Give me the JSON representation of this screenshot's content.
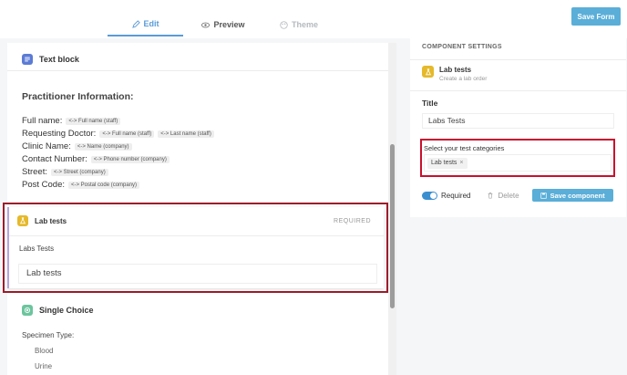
{
  "tabs": {
    "edit": "Edit",
    "preview": "Preview",
    "theme": "Theme"
  },
  "header": {
    "save_form": "Save Form"
  },
  "text_block": {
    "title": "Text block",
    "section_title": "Practitioner Information:",
    "lines": [
      {
        "label": "Full name:",
        "tags": [
          "<-> Full name (staff)"
        ]
      },
      {
        "label": "Requesting Doctor:",
        "tags": [
          "<-> Full name (staff)",
          "<-> Last name (staff)"
        ]
      },
      {
        "label": "Clinic Name:",
        "tags": [
          "<-> Name (company)"
        ]
      },
      {
        "label": "Contact Number:",
        "tags": [
          "<-> Phone number (company)"
        ]
      },
      {
        "label": "Street:",
        "tags": [
          "<-> Street (company)"
        ]
      },
      {
        "label": "Post Code:",
        "tags": [
          "<-> Postal code (company)"
        ]
      }
    ]
  },
  "lab_block": {
    "title": "Lab tests",
    "required": "REQUIRED",
    "field_label": "Labs Tests",
    "input_value": "Lab tests"
  },
  "single_choice": {
    "title": "Single Choice",
    "label": "Specimen Type:",
    "options": [
      "Blood",
      "Urine"
    ]
  },
  "panel": {
    "title": "COMPONENT SETTINGS",
    "component_name": "Lab tests",
    "component_desc": "Create a lab order",
    "title_label": "Title",
    "title_value": "Labs Tests",
    "categories_label": "Select your test categories",
    "chip": "Lab tests",
    "chip_remove": "×",
    "required_label": "Required",
    "delete_label": "Delete",
    "save_component": "Save component"
  },
  "colors": {
    "accent": "#5aaed8",
    "highlight_border": "#c8102e",
    "text_block_icon": "#5b7bd5",
    "lab_icon": "#e5b92a",
    "choice_icon": "#6cc59d"
  }
}
